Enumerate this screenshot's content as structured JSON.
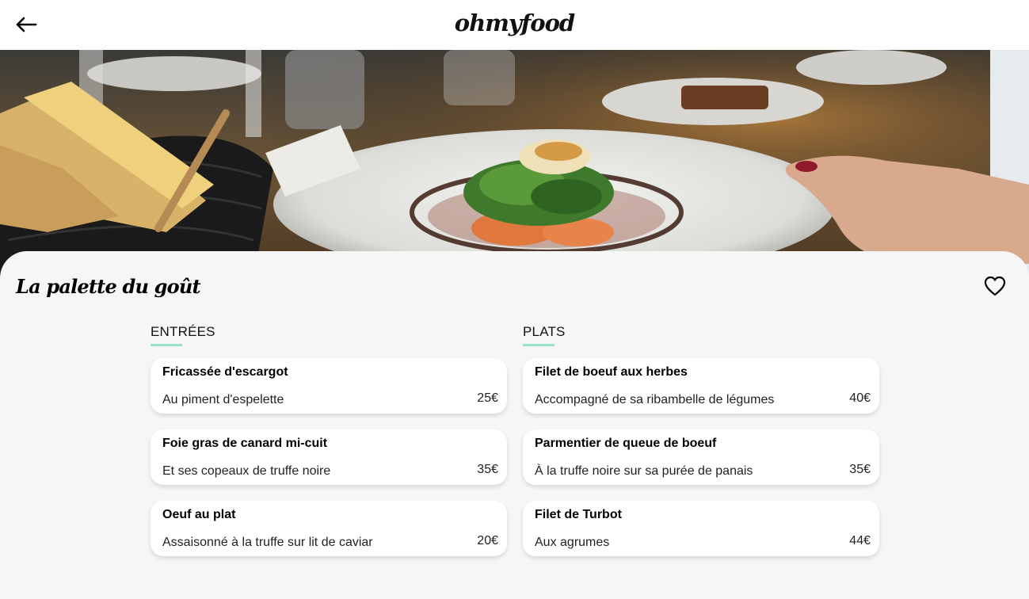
{
  "header": {
    "logo": "ohmyfood"
  },
  "restaurant": {
    "name": "La palette du goût"
  },
  "menu": {
    "entrees": {
      "heading": "ENTRÉES",
      "items": [
        {
          "name": "Fricassée d'escargot",
          "description": "Au piment d'espelette",
          "price": "25€"
        },
        {
          "name": "Foie gras de canard mi-cuit",
          "description": "Et ses copeaux de truffe noire",
          "price": "35€"
        },
        {
          "name": "Oeuf au plat",
          "description": "Assaisonné à la truffe sur lit de caviar",
          "price": "20€"
        }
      ]
    },
    "plats": {
      "heading": "PLATS",
      "items": [
        {
          "name": "Filet de boeuf aux herbes",
          "description": "Accompagné de sa ribambelle de légumes",
          "price": "40€"
        },
        {
          "name": "Parmentier de queue de boeuf",
          "description": "À la truffe noire sur sa purée de panais",
          "price": "35€"
        },
        {
          "name": "Filet de Turbot",
          "description": "Aux agrumes",
          "price": "44€"
        }
      ]
    }
  },
  "colors": {
    "accent": "#99e2d0",
    "background": "#f6f6f6",
    "card": "#ffffff"
  },
  "icons": {
    "back": "arrow-left-icon",
    "favorite": "heart-icon"
  }
}
